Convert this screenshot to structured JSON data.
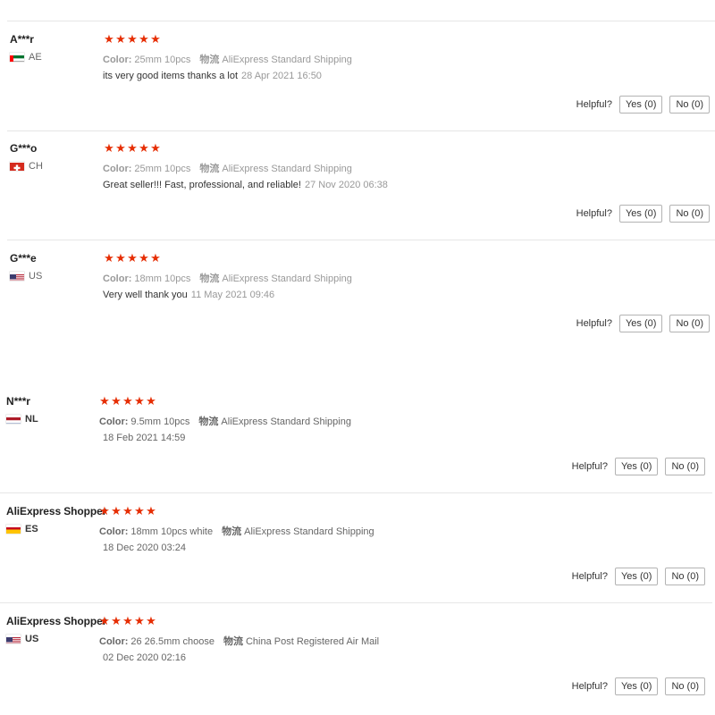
{
  "helpful_label": "Helpful?",
  "star_color": "#e62e04",
  "color_label": "Color:",
  "logistics_label": "物流",
  "reviews": [
    {
      "user": "A***r",
      "country_code": "AE",
      "flag": "ae-flag",
      "rating": 5,
      "color_value": "25mm 10pcs",
      "logistics": "AliExpress Standard Shipping",
      "text": "its very good items thanks a lot",
      "date": "28 Apr 2021 16:50",
      "yes": "Yes (0)",
      "no": "No (0)"
    },
    {
      "user": "G***o",
      "country_code": "CH",
      "flag": "ch-flag",
      "rating": 5,
      "color_value": "25mm 10pcs",
      "logistics": "AliExpress Standard Shipping",
      "text": "Great seller!!! Fast, professional, and reliable!",
      "date": "27 Nov 2020 06:38",
      "yes": "Yes (0)",
      "no": "No (0)"
    },
    {
      "user": "G***e",
      "country_code": "US",
      "flag": "us-flag",
      "rating": 5,
      "color_value": "18mm 10pcs",
      "logistics": "AliExpress Standard Shipping",
      "text": "Very well thank you",
      "date": "11 May 2021 09:46",
      "yes": "Yes (0)",
      "no": "No (0)"
    },
    {
      "user": "N***r",
      "country_code": "NL",
      "flag": "nl-flag",
      "rating": 5,
      "color_value": "9.5mm 10pcs",
      "logistics": "AliExpress Standard Shipping",
      "text": "",
      "date": "18 Feb 2021 14:59",
      "yes": "Yes (0)",
      "no": "No (0)"
    },
    {
      "user": "AliExpress Shopper",
      "country_code": "ES",
      "flag": "es-flag",
      "rating": 5,
      "color_value": "18mm 10pcs white",
      "logistics": "AliExpress Standard Shipping",
      "text": "",
      "date": "18 Dec 2020 03:24",
      "yes": "Yes (0)",
      "no": "No (0)"
    },
    {
      "user": "AliExpress Shopper",
      "country_code": "US",
      "flag": "us-flag",
      "rating": 5,
      "color_value": "26 26.5mm choose",
      "logistics": "China Post Registered Air Mail",
      "text": "",
      "date": "02 Dec 2020 02:16",
      "yes": "Yes (0)",
      "no": "No (0)"
    }
  ]
}
